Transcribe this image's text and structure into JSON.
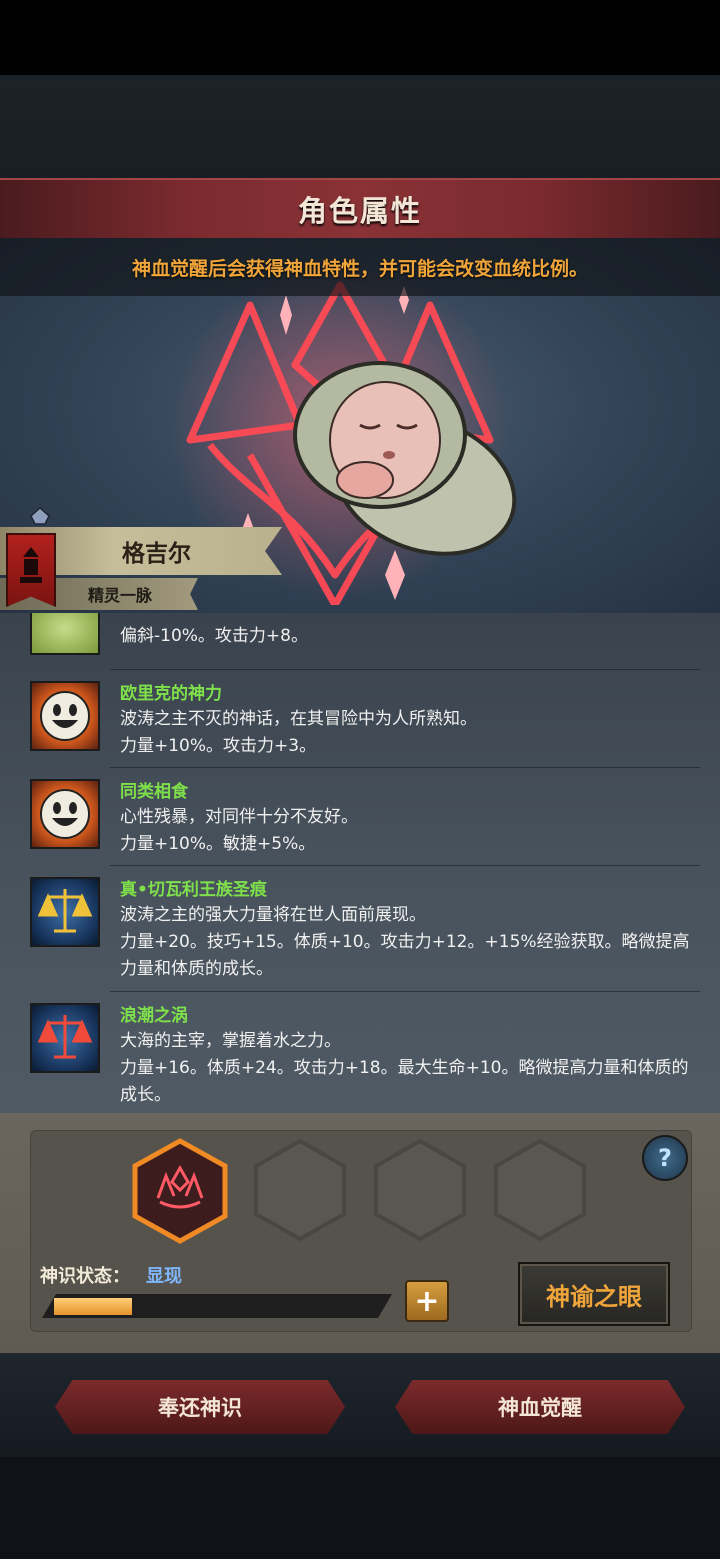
{
  "header": {
    "title": "角色属性"
  },
  "notice": {
    "text": "神血觉醒后会获得神血特性，并可能会改变血统比例。"
  },
  "character": {
    "name": "格吉尔",
    "lineage": "精灵一脉"
  },
  "traits": [
    {
      "name": "",
      "desc": "偏斜-10%。攻击力+8。",
      "icon": "green-face-icon"
    },
    {
      "name": "欧里克的神力",
      "desc": "波涛之主不灭的神话，在其冒险中为人所熟知。\n力量+10%。攻击力+3。",
      "icon": "smiling-face-icon"
    },
    {
      "name": "同类相食",
      "desc": "心性残暴，对同伴十分不友好。\n力量+10%。敏捷+5%。",
      "icon": "smiling-face-icon"
    },
    {
      "name": "真•切瓦利王族圣痕",
      "desc": "波涛之主的强大力量将在世人面前展现。\n力量+20。技巧+15。体质+10。攻击力+12。+15%经验获取。略微提高力量和体质的成长。",
      "icon": "gold-scales-icon"
    },
    {
      "name": "浪潮之涡",
      "desc": "大海的主宰，掌握着水之力。\n力量+16。体质+24。攻击力+18。最大生命+10。略微提高力量和体质的成长。",
      "icon": "red-scales-icon"
    }
  ],
  "divine": {
    "status_label": "神识状态：",
    "status_value": "显现",
    "progress": 0.24,
    "eye_button": "神谕之眼",
    "plus": "+",
    "help": "?"
  },
  "actions": {
    "return_label": "奉还神识",
    "awaken_label": "神血觉醒"
  },
  "colors": {
    "accent": "#f0a53a",
    "trait_name": "#7ee04a",
    "status_value": "#7fb7ff"
  }
}
